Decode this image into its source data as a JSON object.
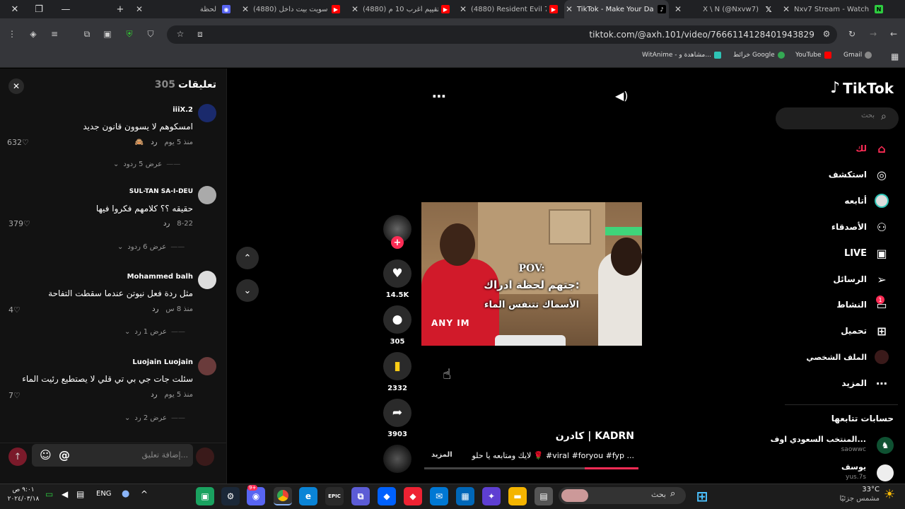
{
  "browser": {
    "tabs": [
      {
        "title": "لحظة",
        "active": false
      },
      {
        "title": "(4880) سويت بيت داخل",
        "active": false
      },
      {
        "title": "(4880) تقييم أغرب 10 م",
        "active": false
      },
      {
        "title": "(4880) Resident Evil 7",
        "active": false
      },
      {
        "title": "TikTok - Make Your Da",
        "active": true
      },
      {
        "title": "X \\ N (@Nxvw7)",
        "active": false
      },
      {
        "title": "Nxv7 Stream - Watch",
        "active": false
      }
    ],
    "url": "tiktok.com/@axh.101/video/7666114128401943829",
    "bookmarks": [
      {
        "label": "WitAnime - مشاهدة و..."
      },
      {
        "label": "خرائط Google"
      },
      {
        "label": "YouTube"
      },
      {
        "label": "Gmail"
      }
    ]
  },
  "comments_panel": {
    "title": "تعليقات",
    "count": "305",
    "input_placeholder": "إضافة تعليق...",
    "reply_label": "رد",
    "items": [
      {
        "user": "iiiX.2",
        "text": "امسكوهم لا يسوون قانون جديد",
        "time": "منذ 5 يوم",
        "likes": "632",
        "replies": "عرض 5 ردود"
      },
      {
        "user": "SUL-TAN SA-I-DEU",
        "text": "حقيقه ؟؟ كلامهم فكروا فيها",
        "time": "8-22",
        "likes": "379",
        "replies": "عرض 6 ردود"
      },
      {
        "user": "Mohammed balh",
        "text": "مثل ردة فعل نيوتن عندما سقطت التفاحة",
        "time": "منذ 8 س",
        "likes": "4",
        "replies": "عرض 1 رد"
      },
      {
        "user": "Luojain Luojain",
        "text": "سئلت جات جي بي تي قلي لا يصتطيع رئيت الماء",
        "time": "منذ 5 يوم",
        "likes": "7",
        "replies": "عرض 2 رد"
      }
    ]
  },
  "video": {
    "overlay_pov": "POV:",
    "overlay_line1": "جتهم لحظة ادراك:",
    "overlay_line2": "الأسماك تتنفس الماء",
    "shirt_text": "ANY IM",
    "likes": "14.5K",
    "comments": "305",
    "saves": "2332",
    "shares": "3903",
    "author": "كادرن | KADRN",
    "caption": "لايك ومتابعه يا حلو 🌹 #viral #foryou #fyp ...",
    "more_label": "المزيد",
    "progress": 0.25
  },
  "sidebar": {
    "logo": "TikTok",
    "search_placeholder": "بحث",
    "nav": [
      {
        "label": "لك",
        "icon": "home-icon"
      },
      {
        "label": "استكشف",
        "icon": "compass-icon"
      },
      {
        "label": "أتابعه",
        "icon": "following-icon"
      },
      {
        "label": "الأصدقاء",
        "icon": "friends-icon"
      },
      {
        "label": "LIVE",
        "icon": "live-icon"
      },
      {
        "label": "الرسائل",
        "icon": "messages-icon"
      },
      {
        "label": "النشاط",
        "icon": "activity-icon",
        "badge": "1"
      },
      {
        "label": "تحميل",
        "icon": "upload-icon"
      },
      {
        "label": "الملف الشخصي",
        "icon": "profile-icon"
      },
      {
        "label": "المزيد",
        "icon": "more-icon"
      }
    ],
    "following_title": "حسابات تتابعها",
    "following": [
      {
        "name": "المنتخب السعودي اوف...",
        "handle": "saowwc"
      },
      {
        "name": "يوسف",
        "handle": "yus.7s"
      }
    ]
  },
  "taskbar": {
    "time": "٩:٠١ ص",
    "date": "٢٠٢٤/٠٣/١٨",
    "lang": "ENG",
    "search_placeholder": "بحث",
    "weather_temp": "33°C",
    "weather_desc": "مشمس جزئيًا",
    "discord_badge": "9+"
  },
  "colors": {
    "accent": "#fe2c55",
    "bg": "#000000",
    "panel": "#121212"
  }
}
